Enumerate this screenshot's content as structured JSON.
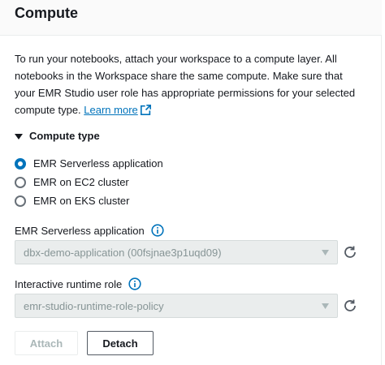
{
  "header": {
    "title": "Compute"
  },
  "description": {
    "text": "To run your notebooks, attach your workspace to a compute layer. All notebooks in the Workspace share the same compute. Make sure that your EMR Studio user role has appropriate permissions for your selected compute type. ",
    "link_label": "Learn more",
    "link_icon": "external-link-icon"
  },
  "compute_type": {
    "title": "Compute type",
    "expanded": true,
    "options": [
      {
        "label": "EMR Serverless application",
        "selected": true
      },
      {
        "label": "EMR on EC2 cluster",
        "selected": false
      },
      {
        "label": "EMR on EKS cluster",
        "selected": false
      }
    ]
  },
  "serverless_app": {
    "label": "EMR Serverless application",
    "value": "dbx-demo-application (00fsjnae3p1uqd09)"
  },
  "runtime_role": {
    "label": "Interactive runtime role",
    "value": "emr-studio-runtime-role-policy"
  },
  "buttons": {
    "attach": "Attach",
    "detach": "Detach"
  },
  "colors": {
    "accent": "#0073bb",
    "text": "#16191f",
    "disabled_text": "#879596"
  }
}
